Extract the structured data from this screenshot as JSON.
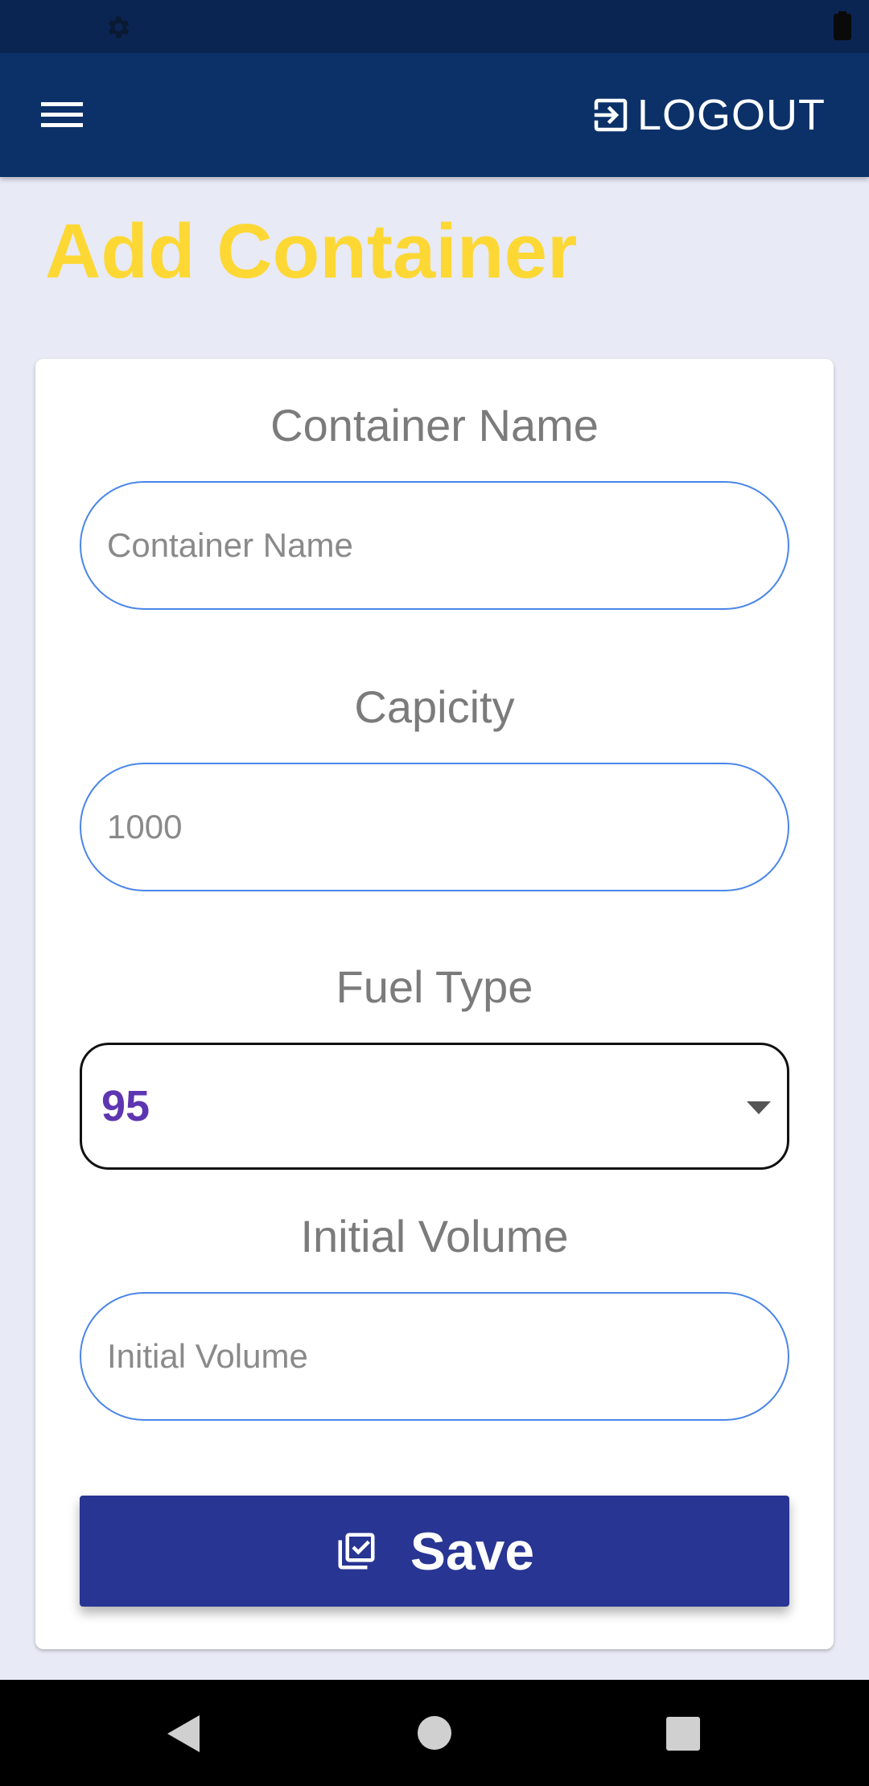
{
  "status_bar": {
    "icons": [
      "gear-icon",
      "battery-icon"
    ]
  },
  "app_bar": {
    "menu_icon": "hamburger-menu-icon",
    "logout_icon": "logout-icon",
    "logout_label": "LOGOUT"
  },
  "page": {
    "title": "Add Container"
  },
  "form": {
    "container_name": {
      "label": "Container Name",
      "placeholder": "Container Name",
      "value": ""
    },
    "capacity": {
      "label": "Capicity",
      "placeholder": "1000",
      "value": ""
    },
    "fuel_type": {
      "label": "Fuel Type",
      "selected": "95"
    },
    "initial_volume": {
      "label": "Initial Volume",
      "placeholder": "Initial Volume",
      "value": ""
    },
    "save": {
      "label": "Save",
      "icon": "save-check-icon"
    }
  },
  "nav_bar": {
    "icons": [
      "back-icon",
      "home-icon",
      "recents-icon"
    ]
  },
  "colors": {
    "title": "#fdd835",
    "app_bar": "#0b3168",
    "save_button": "#283593",
    "select_value": "#5e35b1",
    "input_border": "#4a86e8"
  }
}
